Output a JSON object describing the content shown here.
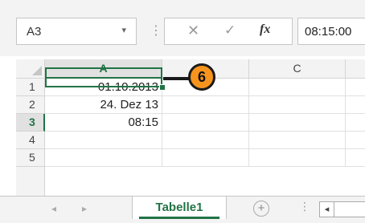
{
  "formula_bar": {
    "name_box": "A3",
    "dropdown_glyph": "▾",
    "separator": "⋮",
    "cancel_glyph": "✕",
    "enter_glyph": "✓",
    "fx_label": "fx",
    "content": "08:15:00"
  },
  "columns": [
    "A",
    "B",
    "C"
  ],
  "rows": [
    {
      "num": "1",
      "A": "01.10.2013"
    },
    {
      "num": "2",
      "A": "24. Dez 13"
    },
    {
      "num": "3",
      "A": "08:15"
    },
    {
      "num": "4",
      "A": ""
    },
    {
      "num": "5",
      "A": ""
    }
  ],
  "active_cell": "A3",
  "callout": {
    "number": "6",
    "color": "#f7941d"
  },
  "sheet_tabs": {
    "prev_glyph": "◂",
    "next_glyph": "▸",
    "active": "Tabelle1",
    "add_glyph": "+",
    "more": "⋮",
    "scroll_left_glyph": "◂"
  },
  "colors": {
    "accent": "#217346"
  }
}
